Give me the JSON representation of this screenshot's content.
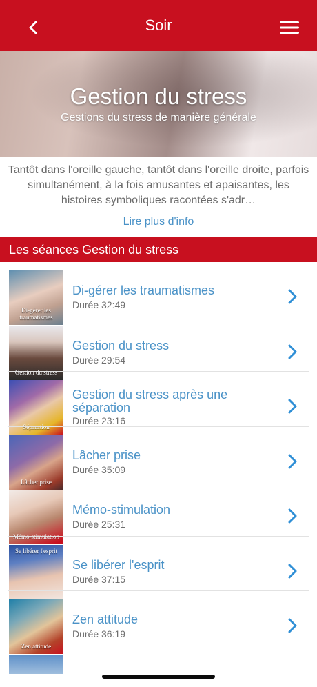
{
  "nav": {
    "title": "Soir",
    "back_icon": "chevron-left-icon",
    "menu_icon": "hamburger-menu-icon"
  },
  "hero": {
    "title": "Gestion du stress",
    "subtitle": "Gestions du stress de manière générale"
  },
  "description": {
    "text": "Tantôt dans l'oreille gauche, tantôt dans l'oreille droite, parfois simultanément, à la fois amusantes et apaisantes, les histoires symboliques racontées s'adr…",
    "read_more": "Lire plus d'info"
  },
  "section": {
    "title": "Les séances Gestion du stress"
  },
  "colors": {
    "brand_red": "#c8101f",
    "link_blue": "#4a92c7",
    "muted_gray": "#6e6e6e"
  },
  "sessions": [
    {
      "title": "Di-gérer les traumatismes",
      "duration": "Durée 32:49",
      "thumb_caption": "Di-gérer les traumatismes"
    },
    {
      "title": "Gestion du stress",
      "duration": "Durée 29:54",
      "thumb_caption": "Gestion du stress"
    },
    {
      "title": "Gestion du stress après une séparation",
      "duration": "Durée 23:16",
      "thumb_caption": "Séparation"
    },
    {
      "title": "Lâcher prise",
      "duration": "Durée 35:09",
      "thumb_caption": "Lâcher prise"
    },
    {
      "title": "Mémo-stimulation",
      "duration": "Durée 25:31",
      "thumb_caption": "Mémo-stimulation"
    },
    {
      "title": "Se libérer l'esprit",
      "duration": "Durée 37:15",
      "thumb_caption": "Se libérer l'esprit"
    },
    {
      "title": "Zen attitude",
      "duration": "Durée 36:19",
      "thumb_caption": "Zen attitude"
    }
  ]
}
